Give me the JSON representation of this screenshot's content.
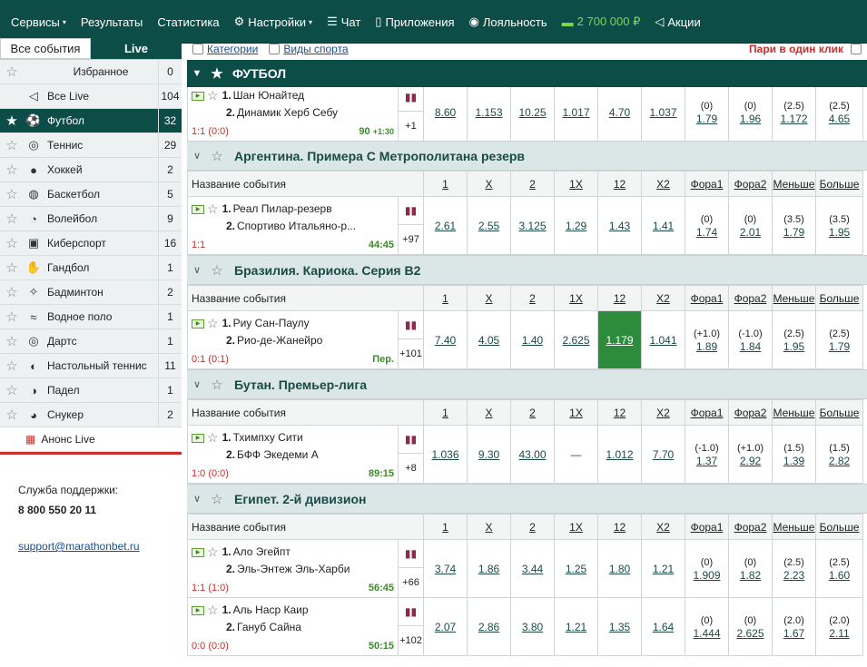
{
  "nav": [
    {
      "label": "Сервисы",
      "caret": true,
      "icon": ""
    },
    {
      "label": "Результаты",
      "caret": false,
      "icon": ""
    },
    {
      "label": "Статистика",
      "caret": false,
      "icon": ""
    },
    {
      "label": "Настройки",
      "caret": true,
      "icon": "gear-icon"
    },
    {
      "label": "Чат",
      "caret": false,
      "icon": "chat-icon"
    },
    {
      "label": "Приложения",
      "caret": false,
      "icon": "phone-icon"
    },
    {
      "label": "Лояльность",
      "caret": false,
      "icon": "loyalty-icon"
    },
    {
      "label": "2 700 000 ₽",
      "caret": false,
      "icon": "car-icon",
      "green": true
    },
    {
      "label": "Акции",
      "caret": false,
      "icon": "megaphone-icon"
    }
  ],
  "sidebar": {
    "tabs": [
      "Все события",
      "Live"
    ],
    "items": [
      {
        "label": "Избранное",
        "count": "0",
        "icon": ""
      },
      {
        "label": "Все Live",
        "count": "104",
        "icon": "megaphone-icon"
      },
      {
        "label": "Футбол",
        "count": "32",
        "icon": "football-icon",
        "active": true
      },
      {
        "label": "Теннис",
        "count": "29",
        "icon": "tennis-icon"
      },
      {
        "label": "Хоккей",
        "count": "2",
        "icon": "hockey-icon"
      },
      {
        "label": "Баскетбол",
        "count": "5",
        "icon": "basketball-icon"
      },
      {
        "label": "Волейбол",
        "count": "9",
        "icon": "volleyball-icon"
      },
      {
        "label": "Киберспорт",
        "count": "16",
        "icon": "gamepad-icon"
      },
      {
        "label": "Гандбол",
        "count": "1",
        "icon": "handball-icon"
      },
      {
        "label": "Бадминтон",
        "count": "2",
        "icon": "badminton-icon"
      },
      {
        "label": "Водное поло",
        "count": "1",
        "icon": "waterpolo-icon"
      },
      {
        "label": "Дартс",
        "count": "1",
        "icon": "darts-icon"
      },
      {
        "label": "Настольный теннис",
        "count": "11",
        "icon": "tabletennis-icon"
      },
      {
        "label": "Падел",
        "count": "1",
        "icon": "padel-icon"
      },
      {
        "label": "Снукер",
        "count": "2",
        "icon": "snooker-icon"
      }
    ],
    "announce": "Анонс Live",
    "support_title": "Служба поддержки:",
    "support_phone": "8 800 550 20 11",
    "support_email": "support@marathonbet.ru"
  },
  "filters": {
    "categories": "Категории",
    "sports": "Виды спорта",
    "one_click": "Пари в один клик"
  },
  "sport_title": "ФУТБОЛ",
  "columns": [
    "Название события",
    "1",
    "X",
    "2",
    "1X",
    "12",
    "X2",
    "Фора1",
    "Фора2",
    "Меньше",
    "Больше"
  ],
  "first_event": {
    "team1": "Шан Юнайтед",
    "team2": "Динамик Херб Себу",
    "score": "1:1 (0:0)",
    "time": "90",
    "extra": "+1:30",
    "more": "+1",
    "odds": [
      "8.60",
      "1.153",
      "10.25",
      "1.017",
      "4.70",
      "1.037"
    ],
    "handicaps": [
      [
        "(0)",
        "1.79"
      ],
      [
        "(0)",
        "1.96"
      ],
      [
        "(2.5)",
        "1.172"
      ],
      [
        "(2.5)",
        "4.65"
      ]
    ]
  },
  "leagues": [
    {
      "name": "Аргентина. Примера С Метрополитана резерв",
      "events": [
        {
          "team1": "Реал Пилар-резерв",
          "team2": "Спортиво Итальяно-р...",
          "score": "1:1",
          "time": "44:45",
          "more": "+97",
          "odds": [
            "2.61",
            "2.55",
            "3.125",
            "1.29",
            "1.43",
            "1.41"
          ],
          "handicaps": [
            [
              "(0)",
              "1.74"
            ],
            [
              "(0)",
              "2.01"
            ],
            [
              "(3.5)",
              "1.79"
            ],
            [
              "(3.5)",
              "1.95"
            ]
          ]
        }
      ]
    },
    {
      "name": "Бразилия. Кариока. Серия B2",
      "events": [
        {
          "team1": "Риу Сан-Паулу",
          "team2": "Рио-де-Жанейро",
          "score": "0:1 (0:1)",
          "time": "Пер.",
          "more": "+101",
          "odds": [
            "7.40",
            "4.05",
            "1.40",
            "2.625",
            "1.179",
            "1.041"
          ],
          "selected": 4,
          "handicaps": [
            [
              "(+1.0)",
              "1.89"
            ],
            [
              "(-1.0)",
              "1.84"
            ],
            [
              "(2.5)",
              "1.95"
            ],
            [
              "(2.5)",
              "1.79"
            ]
          ]
        }
      ]
    },
    {
      "name": "Бутан. Премьер-лига",
      "events": [
        {
          "team1": "Тхимпху Сити",
          "team2": "БФФ Экедеми А",
          "score": "1:0 (0:0)",
          "time": "89:15",
          "more": "+8",
          "odds": [
            "1.036",
            "9.30",
            "43.00",
            "—",
            "1.012",
            "7.70"
          ],
          "handicaps": [
            [
              "(-1.0)",
              "1.37"
            ],
            [
              "(+1.0)",
              "2.92"
            ],
            [
              "(1.5)",
              "1.39"
            ],
            [
              "(1.5)",
              "2.82"
            ]
          ]
        }
      ]
    },
    {
      "name": "Египет. 2-й дивизион",
      "events": [
        {
          "team1": "Ало Эгейпт",
          "team2": "Эль-Энтеж Эль-Харби",
          "score": "1:1 (1:0)",
          "time": "56:45",
          "more": "+66",
          "odds": [
            "3.74",
            "1.86",
            "3.44",
            "1.25",
            "1.80",
            "1.21"
          ],
          "handicaps": [
            [
              "(0)",
              "1.909"
            ],
            [
              "(0)",
              "1.82"
            ],
            [
              "(2.5)",
              "2.23"
            ],
            [
              "(2.5)",
              "1.60"
            ]
          ]
        },
        {
          "team1": "Аль Наср Каир",
          "team2": "Гануб Сайна",
          "score": "0:0 (0:0)",
          "time": "50:15",
          "more": "+102",
          "odds": [
            "2.07",
            "2.86",
            "3.80",
            "1.21",
            "1.35",
            "1.64"
          ],
          "handicaps": [
            [
              "(0)",
              "1.444"
            ],
            [
              "(0)",
              "2.625"
            ],
            [
              "(2.0)",
              "1.67"
            ],
            [
              "(2.0)",
              "2.11"
            ]
          ]
        }
      ]
    }
  ]
}
